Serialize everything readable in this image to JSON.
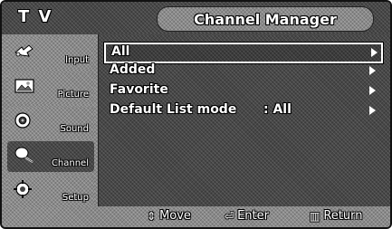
{
  "header": {
    "section": "T V",
    "title": "Channel Manager"
  },
  "sidebar": {
    "items": [
      {
        "label": "Input",
        "icon": "input-icon"
      },
      {
        "label": "Picture",
        "icon": "picture-icon"
      },
      {
        "label": "Sound",
        "icon": "sound-icon"
      },
      {
        "label": "Channel",
        "icon": "channel-icon"
      },
      {
        "label": "Setup",
        "icon": "setup-icon"
      }
    ],
    "active_item": "Channel"
  },
  "menu": {
    "items": [
      {
        "label": "All",
        "value": ""
      },
      {
        "label": "Added",
        "value": ""
      },
      {
        "label": "Favorite",
        "value": ""
      },
      {
        "label": "Default List mode",
        "value": ": All"
      }
    ],
    "selected_index": 0
  },
  "footer": {
    "move": {
      "glyph": "⇕",
      "label": "Move"
    },
    "enter": {
      "glyph": "⏎",
      "label": "Enter"
    },
    "return": {
      "glyph": "▥",
      "label": "Return"
    }
  }
}
